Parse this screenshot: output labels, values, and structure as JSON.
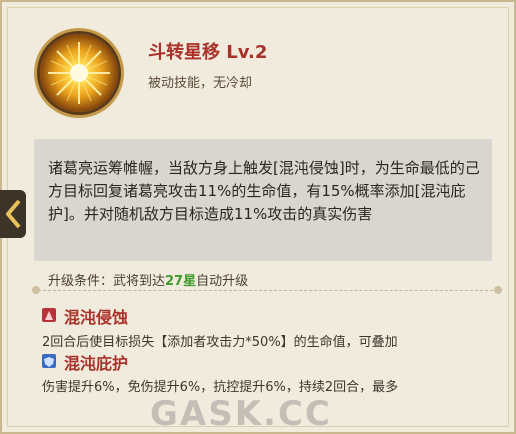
{
  "skill": {
    "name": "斗转星移 Lv.2",
    "type": "被动技能，无冷却",
    "icon": "sun-burst-icon"
  },
  "description": "诸葛亮运筹帷幄，当敌方身上触发[混沌侵蚀]时，为生命最低的己方目标回复诸葛亮攻击11%的生命值，有15%概率添加[混沌庇护]。并对随机敌方目标造成11%攻击的真实伤害",
  "upgrade": {
    "prefix": "升级条件：武将到达",
    "highlight": "27星",
    "suffix": "自动升级",
    "highlight_color": "#3e9a2a"
  },
  "effects": [
    {
      "icon": "chaos-erosion-icon",
      "title": "混沌侵蚀",
      "text": "2回合后使目标损失【添加者攻击力*50%】的生命值，可叠加"
    },
    {
      "icon": "chaos-shield-icon",
      "title": "混沌庇护",
      "text": "伤害提升6%，免伤提升6%，抗控提升6%，持续2回合，最多"
    }
  ],
  "watermark": "GASK.CC",
  "colors": {
    "title": "#a8322a",
    "panel": "#f1ebdd",
    "desc_box": "#d9d6cf"
  }
}
